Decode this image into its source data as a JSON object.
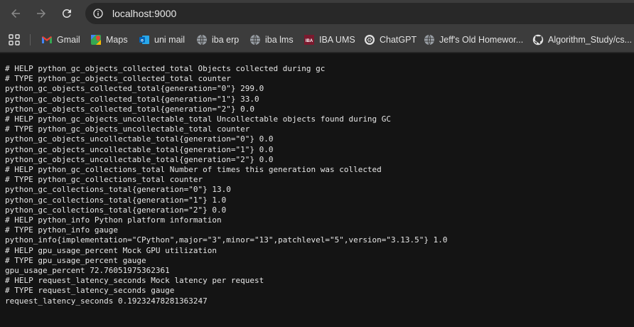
{
  "toolbar": {
    "url": "localhost:9000"
  },
  "bookmarks": [
    {
      "label": "Gmail",
      "icon": "gmail-icon"
    },
    {
      "label": "Maps",
      "icon": "maps-icon"
    },
    {
      "label": "uni mail",
      "icon": "outlook-icon"
    },
    {
      "label": "iba erp",
      "icon": "globe-icon"
    },
    {
      "label": "iba lms",
      "icon": "globe-icon"
    },
    {
      "label": "IBA UMS",
      "icon": "iba-logo-icon"
    },
    {
      "label": "ChatGPT",
      "icon": "chatgpt-icon"
    },
    {
      "label": "Jeff's Old Homewor...",
      "icon": "globe-icon"
    },
    {
      "label": "Algorithm_Study/cs...",
      "icon": "github-icon"
    }
  ],
  "content": {
    "lines": [
      "# HELP python_gc_objects_collected_total Objects collected during gc",
      "# TYPE python_gc_objects_collected_total counter",
      "python_gc_objects_collected_total{generation=\"0\"} 299.0",
      "python_gc_objects_collected_total{generation=\"1\"} 33.0",
      "python_gc_objects_collected_total{generation=\"2\"} 0.0",
      "# HELP python_gc_objects_uncollectable_total Uncollectable objects found during GC",
      "# TYPE python_gc_objects_uncollectable_total counter",
      "python_gc_objects_uncollectable_total{generation=\"0\"} 0.0",
      "python_gc_objects_uncollectable_total{generation=\"1\"} 0.0",
      "python_gc_objects_uncollectable_total{generation=\"2\"} 0.0",
      "# HELP python_gc_collections_total Number of times this generation was collected",
      "# TYPE python_gc_collections_total counter",
      "python_gc_collections_total{generation=\"0\"} 13.0",
      "python_gc_collections_total{generation=\"1\"} 1.0",
      "python_gc_collections_total{generation=\"2\"} 0.0",
      "# HELP python_info Python platform information",
      "# TYPE python_info gauge",
      "python_info{implementation=\"CPython\",major=\"3\",minor=\"13\",patchlevel=\"5\",version=\"3.13.5\"} 1.0",
      "# HELP gpu_usage_percent Mock GPU utilization",
      "# TYPE gpu_usage_percent gauge",
      "gpu_usage_percent 72.76051975362361",
      "# HELP request_latency_seconds Mock latency per request",
      "# TYPE request_latency_seconds gauge",
      "request_latency_seconds 0.19232478281363247"
    ]
  }
}
